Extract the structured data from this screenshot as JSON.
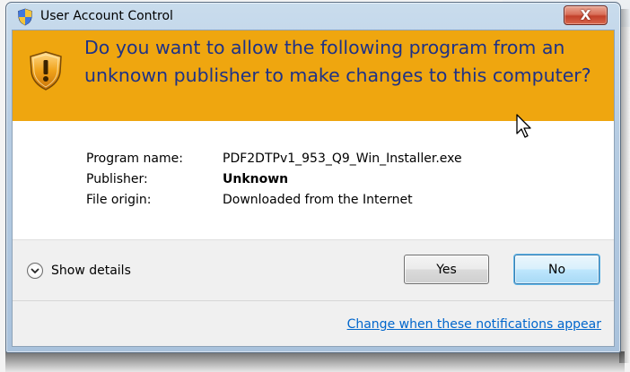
{
  "window": {
    "title": "User Account Control",
    "close_glyph": "X"
  },
  "banner": {
    "question": "Do you want to allow the following program from an unknown publisher to make changes to this computer?",
    "icon": "warning-shield-icon",
    "color": "#efa60f"
  },
  "details": {
    "program_name_label": "Program name:",
    "program_name_value": "PDF2DTPv1_953_Q9_Win_Installer.exe",
    "publisher_label": "Publisher:",
    "publisher_value": "Unknown",
    "file_origin_label": "File origin:",
    "file_origin_value": "Downloaded from the Internet"
  },
  "footer": {
    "show_details_label": "Show details",
    "yes_label": "Yes",
    "no_label": "No",
    "notifications_link": "Change when these notifications appear"
  },
  "colors": {
    "banner_text": "#1e3287",
    "link": "#0066cc",
    "close_button": "#c2402a"
  },
  "icons": [
    "uac-shield-icon",
    "warning-shield-icon",
    "close-icon",
    "chevron-down-icon",
    "mouse-cursor-icon"
  ]
}
